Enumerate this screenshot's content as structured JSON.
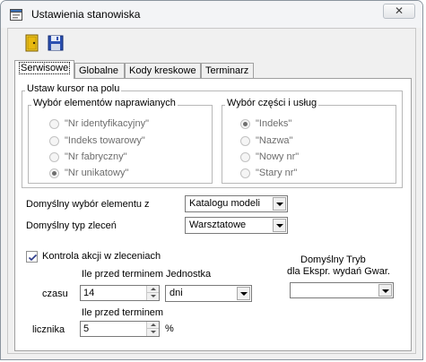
{
  "window": {
    "title": "Ustawienia stanowiska",
    "close_label": "✕"
  },
  "toolbar": {
    "exit_icon": "door-exit-icon",
    "save_icon": "floppy-save-icon"
  },
  "tabs": [
    {
      "label": "Serwisowe",
      "active": true
    },
    {
      "label": "Globalne",
      "active": false
    },
    {
      "label": "Kody kreskowe",
      "active": false
    },
    {
      "label": "Terminarz",
      "active": false
    }
  ],
  "cursor_group": {
    "label": "Ustaw kursor na polu",
    "elements_group": {
      "label": "Wybór elementów naprawianych",
      "options": [
        "\"Nr identyfikacyjny\"",
        "\"Indeks towarowy\"",
        "\"Nr fabryczny\"",
        "\"Nr unikatowy\""
      ],
      "selected": 3
    },
    "parts_group": {
      "label": "Wybór części i usług",
      "options": [
        "\"Indeks\"",
        "\"Nazwa\"",
        "\"Nowy nr\"",
        "\"Stary nr\""
      ],
      "selected": 0
    }
  },
  "default_element": {
    "label": "Domyślny wybór elementu z",
    "value": "Katalogu modeli"
  },
  "default_order_type": {
    "label": "Domyślny typ zleceń",
    "value": "Warsztatowe"
  },
  "action_control": {
    "label": "Kontrola akcji w zleceniach",
    "checked": true,
    "before_term_label": "Ile przed terminem",
    "unit_label": "Jednostka",
    "time_label": "czasu",
    "time_value": "14",
    "unit_value": "dni",
    "before_term_label_2": "Ile przed terminem",
    "counter_label": "licznika",
    "counter_value": "5",
    "percent_label": "%"
  },
  "issue_mode": {
    "label_line1": "Domyślny Tryb",
    "label_line2": "dla Ekspr. wydań Gwar.",
    "value": ""
  }
}
